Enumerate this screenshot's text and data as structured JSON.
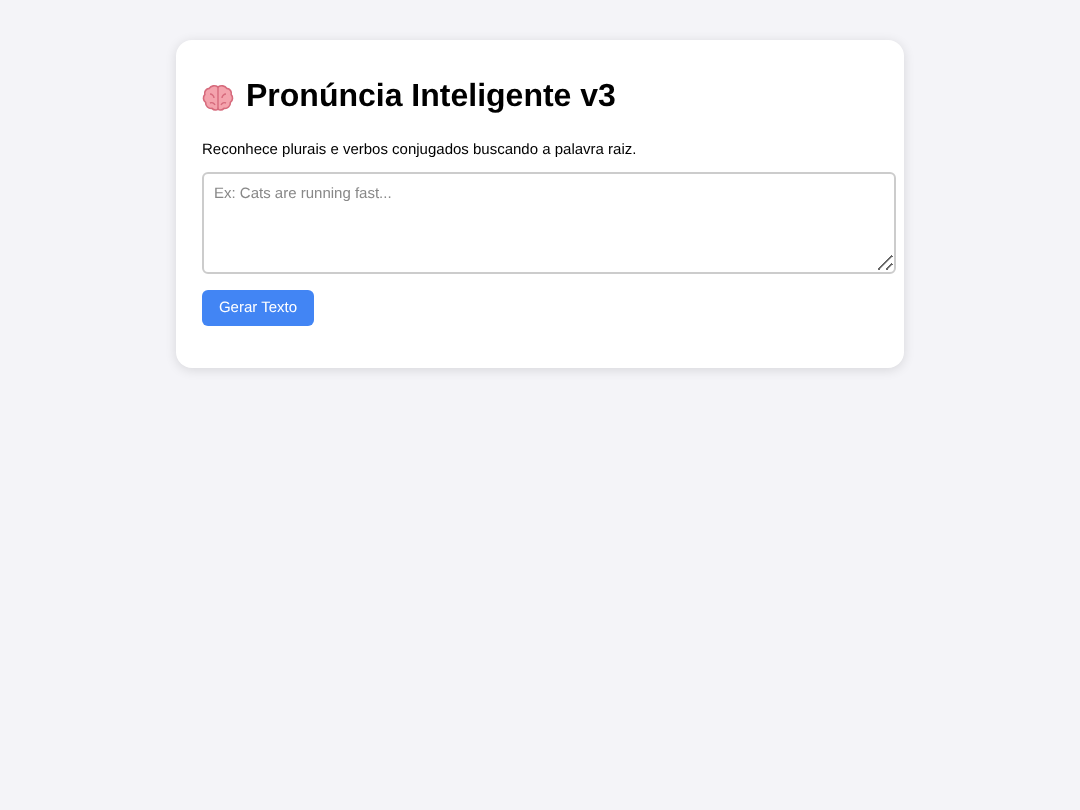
{
  "card": {
    "title": "Pronúncia Inteligente v3",
    "description": "Reconhece plurais e verbos conjugados buscando a palavra raiz.",
    "text_input": {
      "placeholder": "Ex: Cats are running fast..."
    },
    "button": "Gerar Texto"
  }
}
